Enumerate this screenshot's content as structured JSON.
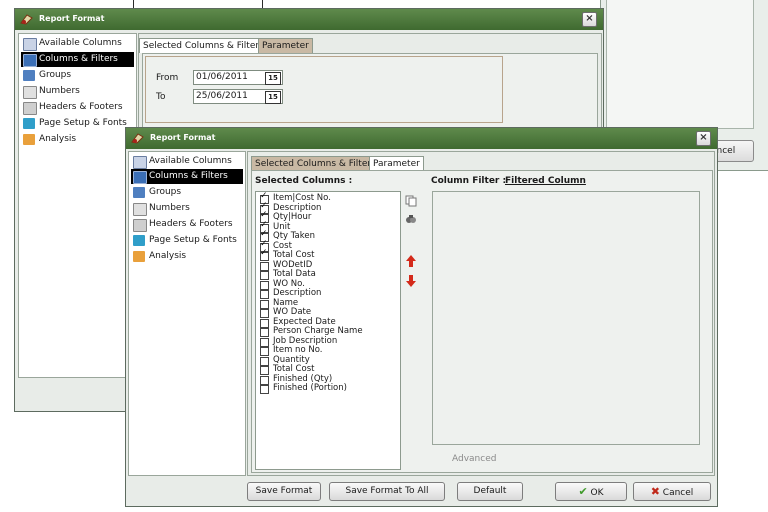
{
  "window_title": "Report Format",
  "close_glyph": "×",
  "nav": [
    {
      "label": "Available Columns",
      "icon": "table-icon",
      "color": "#c9d3e6"
    },
    {
      "label": "Columns & Filters",
      "icon": "columns-icon",
      "color": "#3b6fb6"
    },
    {
      "label": "Groups",
      "icon": "groups-icon",
      "color": "#4f7fc0"
    },
    {
      "label": "Numbers",
      "icon": "numbers-icon",
      "color": "#e0e0e0"
    },
    {
      "label": "Headers & Footers",
      "icon": "headers-footers-icon",
      "color": "#cfcfcf"
    },
    {
      "label": "Page Setup & Fonts",
      "icon": "page-setup-icon",
      "color": "#2f9ec9"
    },
    {
      "label": "Analysis",
      "icon": "analysis-icon",
      "color": "#e9a03b"
    }
  ],
  "back": {
    "tabs": [
      "Selected Columns & Filters",
      "Parameter"
    ],
    "from_label": "From",
    "from_value": "01/06/2011",
    "to_label": "To",
    "to_value": "25/06/2011",
    "cancel_partial": "ancel",
    "cal_glyph": "15"
  },
  "front": {
    "tabs": [
      "Selected Columns & Filters",
      "Parameter"
    ],
    "selected_columns_label": "Selected Columns :",
    "column_filter_label": "Column Filter :",
    "filtered_column_link": "Filtered Column",
    "advanced": "Advanced",
    "columns": [
      {
        "label": "Item|Cost No.",
        "checked": true
      },
      {
        "label": "Description",
        "checked": true
      },
      {
        "label": "Qty|Hour",
        "checked": true
      },
      {
        "label": "Unit",
        "checked": true
      },
      {
        "label": "Qty Taken",
        "checked": true
      },
      {
        "label": "Cost",
        "checked": true
      },
      {
        "label": "Total Cost",
        "checked": true
      },
      {
        "label": "WODetID",
        "checked": false
      },
      {
        "label": "Total Data",
        "checked": false
      },
      {
        "label": "WO No.",
        "checked": false
      },
      {
        "label": "Description",
        "checked": false
      },
      {
        "label": "Name",
        "checked": false
      },
      {
        "label": "WO Date",
        "checked": false
      },
      {
        "label": "Expected Date",
        "checked": false
      },
      {
        "label": "Person Charge Name",
        "checked": false
      },
      {
        "label": "Job Description",
        "checked": false
      },
      {
        "label": "Item no No.",
        "checked": false
      },
      {
        "label": "Quantity",
        "checked": false
      },
      {
        "label": "Total Cost",
        "checked": false
      },
      {
        "label": "Finished (Qty)",
        "checked": false
      },
      {
        "label": "Finished (Portion)",
        "checked": false
      }
    ],
    "buttons": {
      "save_format": "Save Format",
      "save_format_to_all": "Save Format To All",
      "default": "Default",
      "ok": "OK",
      "cancel": "Cancel"
    }
  },
  "colors": {
    "titlebar": "#4f7a3e",
    "tab_inactive": "#c9b9a4",
    "arrow_red": "#d42a1a",
    "ok_green": "#3f9a2a",
    "cancel_red": "#c0291b"
  }
}
